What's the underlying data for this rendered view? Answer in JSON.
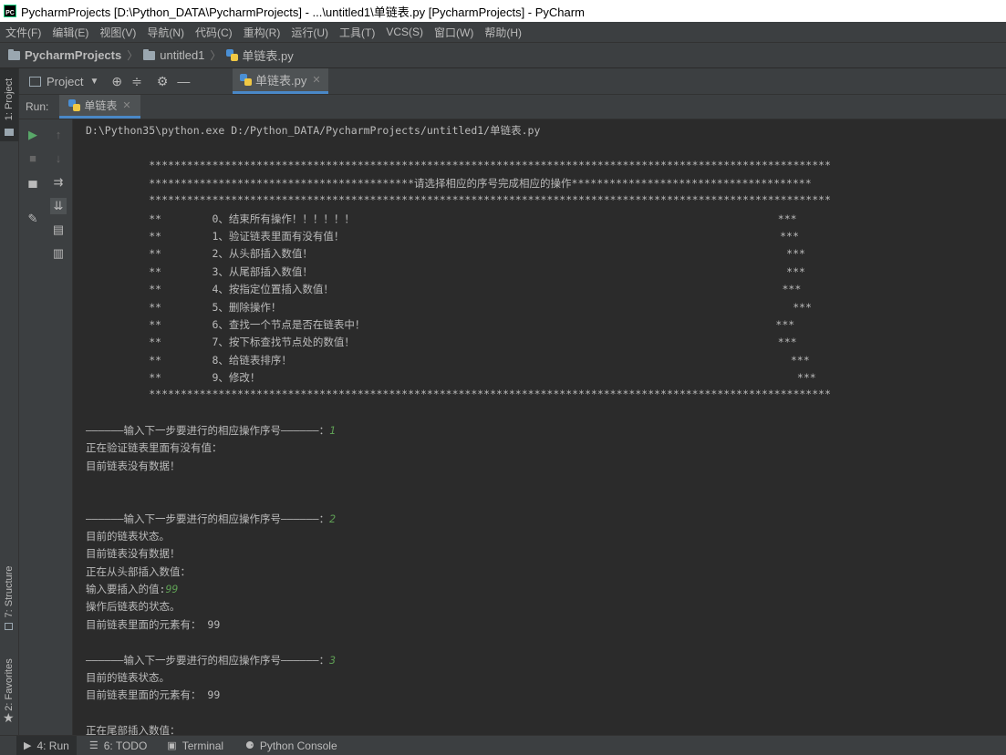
{
  "window": {
    "title": "PycharmProjects [D:\\Python_DATA\\PycharmProjects] - ...\\untitled1\\单链表.py [PycharmProjects] - PyCharm"
  },
  "menu": [
    "文件(F)",
    "编辑(E)",
    "视图(V)",
    "导航(N)",
    "代码(C)",
    "重构(R)",
    "运行(U)",
    "工具(T)",
    "VCS(S)",
    "窗口(W)",
    "帮助(H)"
  ],
  "breadcrumb": {
    "root": "PycharmProjects",
    "folder": "untitled1",
    "file": "单链表.py"
  },
  "toolwindow": {
    "project_label": "Project",
    "editor_tab": "单链表.py"
  },
  "left_strip": {
    "project": "1: Project",
    "structure": "7: Structure",
    "favorites": "2: Favorites"
  },
  "run": {
    "label": "Run:",
    "tab": "单链表"
  },
  "console": {
    "lines": [
      {
        "t": "D:\\Python35\\python.exe D:/Python_DATA/PycharmProjects/untitled1/单链表.py"
      },
      {
        "t": ""
      },
      {
        "t": "          ************************************************************************************************************"
      },
      {
        "t": "          ******************************************请选择相应的序号完成相应的操作**************************************"
      },
      {
        "t": "          ************************************************************************************************************"
      },
      {
        "t": "          **        0、结束所有操作！！！！！！                                                                   ***"
      },
      {
        "t": "          **        1、验证链表里面有没有值！                                                                     ***"
      },
      {
        "t": "          **        2、从头部插入数值！                                                                           ***"
      },
      {
        "t": "          **        3、从尾部插入数值！                                                                           ***"
      },
      {
        "t": "          **        4、按指定位置插入数值！                                                                       ***"
      },
      {
        "t": "          **        5、删除操作！                                                                                 ***"
      },
      {
        "t": "          **        6、查找一个节点是否在链表中！                                                                 ***"
      },
      {
        "t": "          **        7、按下标查找节点处的数值！                                                                   ***"
      },
      {
        "t": "          **        8、给链表排序！                                                                               ***"
      },
      {
        "t": "          **        9、修改！                                                                                     ***"
      },
      {
        "t": "          ************************************************************************************************************"
      },
      {
        "t": ""
      },
      {
        "t": "——————输入下一步要进行的相应操作序号——————：",
        "in": "1"
      },
      {
        "t": "正在验证链表里面有没有值："
      },
      {
        "t": "目前链表没有数据！"
      },
      {
        "t": ""
      },
      {
        "t": ""
      },
      {
        "t": "——————输入下一步要进行的相应操作序号——————：",
        "in": "2"
      },
      {
        "t": "目前的链表状态。"
      },
      {
        "t": "目前链表没有数据！"
      },
      {
        "t": "正在从头部插入数值："
      },
      {
        "t": "输入要插入的值:",
        "in": "99"
      },
      {
        "t": "操作后链表的状态。"
      },
      {
        "t": "目前链表里面的元素有： 99"
      },
      {
        "t": ""
      },
      {
        "t": "——————输入下一步要进行的相应操作序号——————：",
        "in": "3"
      },
      {
        "t": "目前的链表状态。"
      },
      {
        "t": "目前链表里面的元素有： 99"
      },
      {
        "t": ""
      },
      {
        "t": "正在尾部插入数值："
      }
    ]
  },
  "statusbar": {
    "run": "4: Run",
    "todo": "6: TODO",
    "terminal": "Terminal",
    "python_console": "Python Console"
  }
}
